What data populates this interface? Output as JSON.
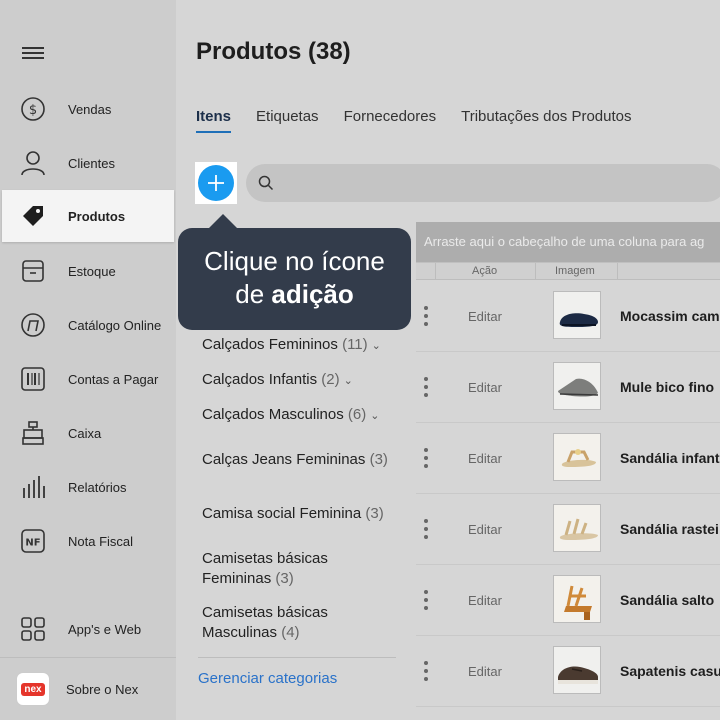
{
  "page": {
    "title": "Produtos (38)"
  },
  "sidebar": {
    "items": [
      {
        "label": "Vendas",
        "icon": "dollar-circle-icon"
      },
      {
        "label": "Clientes",
        "icon": "person-icon"
      },
      {
        "label": "Produtos",
        "icon": "tag-icon",
        "active": true
      },
      {
        "label": "Estoque",
        "icon": "box-icon"
      },
      {
        "label": "Catálogo Online",
        "icon": "store-icon"
      },
      {
        "label": "Contas a Pagar",
        "icon": "barcode-icon"
      },
      {
        "label": "Caixa",
        "icon": "cash-register-icon"
      },
      {
        "label": "Relatórios",
        "icon": "bar-chart-icon"
      },
      {
        "label": "Nota Fiscal",
        "icon": "nf-icon",
        "icon_text": "NF"
      }
    ],
    "bottom": [
      {
        "label": "App's e Web",
        "icon": "apps-grid-icon"
      },
      {
        "label": "Sobre o Nex",
        "icon": "nex-logo",
        "icon_text": "nex"
      }
    ]
  },
  "tabs": [
    {
      "label": "Itens",
      "active": true
    },
    {
      "label": "Etiquetas"
    },
    {
      "label": "Fornecedores"
    },
    {
      "label": "Tributações dos Produtos"
    }
  ],
  "search": {
    "placeholder": "",
    "value": ""
  },
  "tooltip": {
    "line1": "Clique no ícone",
    "line2_prefix": "de ",
    "line2_bold": "adição"
  },
  "categories": [
    {
      "name": "Calçados Femininos",
      "count": "(11)",
      "expandable": true
    },
    {
      "name": "Calçados Infantis",
      "count": "(2)",
      "expandable": true
    },
    {
      "name": "Calçados Masculinos",
      "count": "(6)",
      "expandable": true
    },
    {
      "name": "Calças Jeans Femininas",
      "count": "(3)",
      "expandable": false
    },
    {
      "name": "Camisa social Feminina",
      "count": "(3)",
      "expandable": false
    },
    {
      "name": "Camisetas básicas Femininas",
      "line1": "Camisetas básicas",
      "line2": "Femininas",
      "count": "(3)",
      "expandable": false
    },
    {
      "name": "Camisetas básicas Masculinas",
      "line1": "Camisetas básicas",
      "line2": "Masculinas",
      "count": "(4)",
      "expandable": false
    }
  ],
  "manage_categories": "Gerenciar categorias",
  "grid": {
    "group_hint": "Arraste aqui o cabeçalho de uma coluna para ag",
    "columns": [
      "Ação",
      "Imagem"
    ],
    "edit_label": "Editar",
    "rows": [
      {
        "name": "Mocassim cam",
        "image": "navy-loafer"
      },
      {
        "name": "Mule bico fino",
        "image": "grey-mule"
      },
      {
        "name": "Sandália infant",
        "image": "beige-kids-sandal"
      },
      {
        "name": "Sandália rastei",
        "image": "beige-flat-sandal"
      },
      {
        "name": "Sandália salto",
        "image": "tan-heel-sandal"
      },
      {
        "name": "Sapatenis casu",
        "image": "brown-sneaker"
      }
    ]
  },
  "colors": {
    "accent": "#1a9bf0",
    "tooltip_bg": "#333c4b",
    "link": "#2a72c9",
    "brand_red": "#e5352b"
  }
}
